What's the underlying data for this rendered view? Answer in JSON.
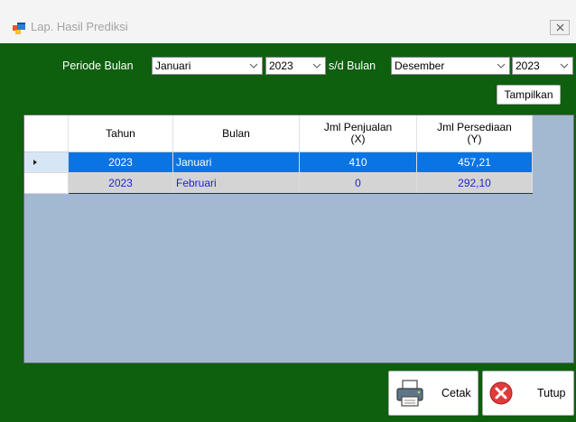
{
  "window": {
    "title": "Lap. Hasil Prediksi"
  },
  "filter": {
    "periode_label": "Periode Bulan",
    "start_month": "Januari",
    "start_year": "2023",
    "sd_label": "s/d Bulan",
    "end_month": "Desember",
    "end_year": "2023",
    "show_button": "Tampilkan"
  },
  "grid": {
    "columns": [
      {
        "line1": "Tahun",
        "line2": ""
      },
      {
        "line1": "Bulan",
        "line2": ""
      },
      {
        "line1": "Jml Penjualan",
        "line2": "(X)"
      },
      {
        "line1": "Jml Persediaan",
        "line2": "(Y)"
      }
    ],
    "rows": [
      {
        "tahun": "2023",
        "bulan": "Januari",
        "penjualan": "410",
        "persediaan": "457,21"
      },
      {
        "tahun": "2023",
        "bulan": "Februari",
        "penjualan": "0",
        "persediaan": "292,10"
      }
    ]
  },
  "actions": {
    "print_label": "Cetak",
    "close_label": "Tutup"
  },
  "colors": {
    "background": "#0e5f0e",
    "selection": "#0a74e4",
    "grid_area": "#a3b8d1"
  }
}
